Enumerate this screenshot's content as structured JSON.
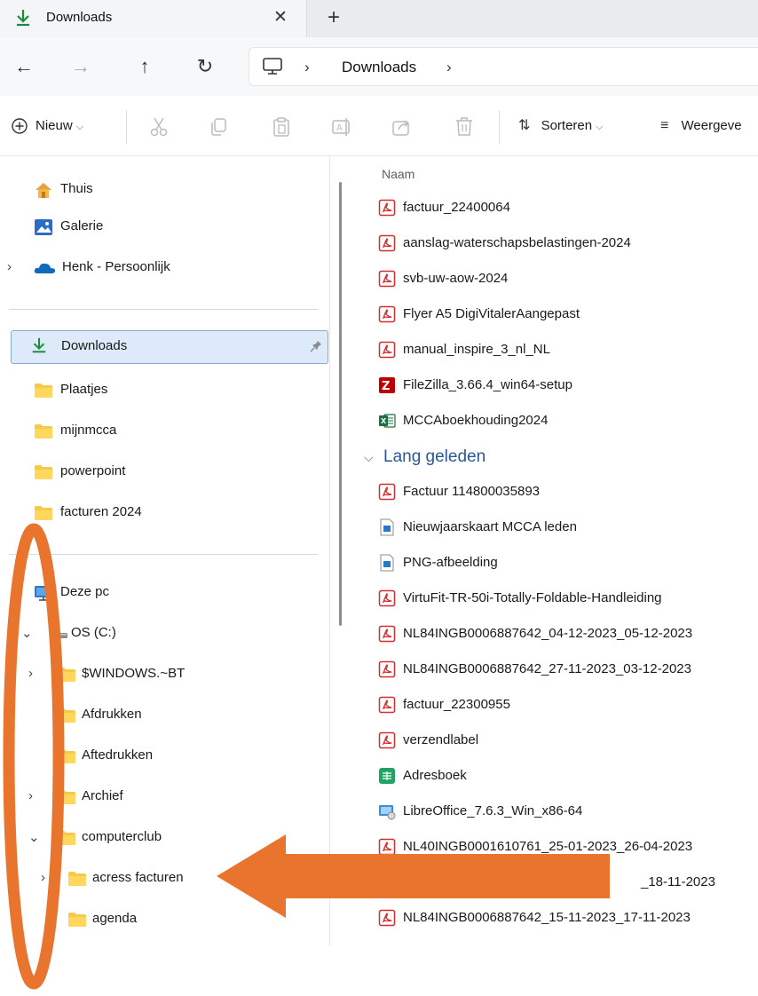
{
  "tab": {
    "title": "Downloads",
    "close_glyph": "✕",
    "new_glyph": "+"
  },
  "address": {
    "back_glyph": "←",
    "forward_glyph": "→",
    "up_glyph": "↑",
    "refresh_glyph": "↻",
    "sep_glyph": "›",
    "location": "Downloads"
  },
  "toolbar": {
    "new_label": "Nieuw",
    "sort_label": "Sorteren",
    "view_label": "Weergeve"
  },
  "nav": {
    "quick": [
      {
        "label": "Thuis",
        "icon": "home-icon"
      },
      {
        "label": "Galerie",
        "icon": "gallery-icon"
      },
      {
        "label": "Henk - Persoonlijk",
        "icon": "onedrive-cloud-icon"
      }
    ],
    "pinned": [
      {
        "label": "Downloads",
        "icon": "download-icon"
      },
      {
        "label": "Plaatjes",
        "icon": "folder-icon"
      },
      {
        "label": "mijnmcca",
        "icon": "folder-icon"
      },
      {
        "label": "powerpoint",
        "icon": "folder-icon"
      },
      {
        "label": "facturen 2024",
        "icon": "folder-icon"
      }
    ],
    "tree": [
      {
        "label": "Deze pc",
        "icon": "pc-icon"
      },
      {
        "label": "OS (C:)",
        "icon": "drive-icon"
      },
      {
        "label": "$WINDOWS.~BT",
        "icon": "folder-icon"
      },
      {
        "label": "Afdrukken",
        "icon": "folder-icon"
      },
      {
        "label": "Aftedrukken",
        "icon": "folder-icon"
      },
      {
        "label": "Archief",
        "icon": "folder-icon"
      },
      {
        "label": "computerclub",
        "icon": "folder-icon"
      },
      {
        "label": "acress facturen",
        "icon": "folder-icon"
      },
      {
        "label": "agenda",
        "icon": "folder-icon"
      }
    ]
  },
  "files": {
    "column_name": "Naam",
    "group_recent": [
      {
        "name": "factuur_22400064",
        "type": "pdf"
      },
      {
        "name": "aanslag-waterschapsbelastingen-2024",
        "type": "pdf"
      },
      {
        "name": "svb-uw-aow-2024",
        "type": "pdf"
      },
      {
        "name": "Flyer A5 DigiVitalerAangepast",
        "type": "pdf"
      },
      {
        "name": "manual_inspire_3_nl_NL",
        "type": "pdf"
      },
      {
        "name": "FileZilla_3.66.4_win64-setup",
        "type": "filezilla"
      },
      {
        "name": "MCCAboekhouding2024",
        "type": "excel"
      }
    ],
    "group_old_title": "Lang geleden",
    "group_old": [
      {
        "name": "Factuur 114800035893",
        "type": "pdf"
      },
      {
        "name": "Nieuwjaarskaart MCCA leden",
        "type": "image"
      },
      {
        "name": "PNG-afbeelding",
        "type": "image"
      },
      {
        "name": "VirtuFit-TR-50i-Totally-Foldable-Handleiding",
        "type": "pdf"
      },
      {
        "name": "NL84INGB0006887642_04-12-2023_05-12-2023",
        "type": "pdf"
      },
      {
        "name": "NL84INGB0006887642_27-11-2023_03-12-2023",
        "type": "pdf"
      },
      {
        "name": "factuur_22300955",
        "type": "pdf"
      },
      {
        "name": "verzendlabel",
        "type": "pdf"
      },
      {
        "name": "Adresboek",
        "type": "sheet"
      },
      {
        "name": "LibreOffice_7.6.3_Win_x86-64",
        "type": "installer"
      },
      {
        "name": "NL40INGB0001610761_25-01-2023_26-04-2023",
        "type": "pdf"
      },
      {
        "name": "_18-11-2023",
        "type": "pdf-hidden"
      },
      {
        "name": "NL84INGB0006887642_15-11-2023_17-11-2023",
        "type": "pdf"
      }
    ]
  },
  "annotation": {
    "color": "#e8742e"
  }
}
